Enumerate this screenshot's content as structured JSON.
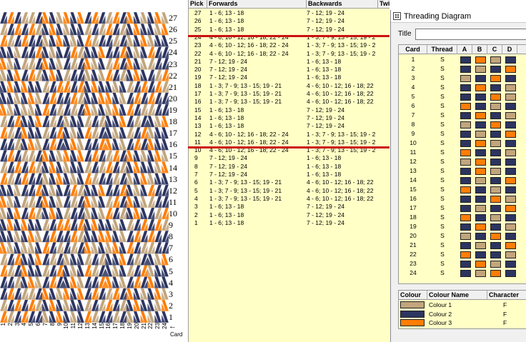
{
  "colors": {
    "colour1": "#c2a57c",
    "colour2": "#2c3460",
    "colour3": "#ff7d05",
    "red_line": "#cc1111",
    "table_bg": "#ffffc6"
  },
  "row_labels": [
    "27",
    "26",
    "25",
    "24",
    "23",
    "22",
    "21",
    "20",
    "19",
    "18",
    "17",
    "16",
    "15",
    "14",
    "13",
    "12",
    "11",
    "10",
    "9",
    "8",
    "7",
    "6",
    "5",
    "4",
    "3",
    "2",
    "1"
  ],
  "card_numbers": [
    "1",
    "2",
    "3",
    "4",
    "5",
    "6",
    "7",
    "8",
    "9",
    "10",
    "11",
    "12",
    "13",
    "14",
    "15",
    "16",
    "17",
    "18",
    "19",
    "20",
    "21",
    "22",
    "23",
    "24"
  ],
  "card_axis": {
    "label": "Card",
    "arrow": "←"
  },
  "pick_table": {
    "headers": {
      "pick": "Pick",
      "forwards": "Forwards",
      "backwards": "Backwards",
      "twist": "Twist"
    },
    "rows": [
      {
        "pick": "27",
        "forwards": "1 - 6; 13 - 18",
        "backwards": "7 - 12; 19 - 24"
      },
      {
        "pick": "26",
        "forwards": "1 - 6; 13 - 18",
        "backwards": "7 - 12; 19 - 24"
      },
      {
        "pick": "25",
        "forwards": "1 - 6; 13 - 18",
        "backwards": "7 - 12; 19 - 24"
      },
      {
        "pick": "24",
        "forwards": "4 - 6; 10 - 12; 16 - 18; 22 - 24",
        "backwards": "1 - 3; 7 - 9; 13 - 15; 19 - 2"
      },
      {
        "pick": "23",
        "forwards": "4 - 6; 10 - 12; 16 - 18; 22 - 24",
        "backwards": "1 - 3; 7 - 9; 13 - 15; 19 - 2"
      },
      {
        "pick": "22",
        "forwards": "4 - 6; 10 - 12; 16 - 18; 22 - 24",
        "backwards": "1 - 3; 7 - 9; 13 - 15; 19 - 2"
      },
      {
        "pick": "21",
        "forwards": "7 - 12; 19 - 24",
        "backwards": "1 - 6; 13 - 18"
      },
      {
        "pick": "20",
        "forwards": "7 - 12; 19 - 24",
        "backwards": "1 - 6; 13 - 18"
      },
      {
        "pick": "19",
        "forwards": "7 - 12; 19 - 24",
        "backwards": "1 - 6; 13 - 18"
      },
      {
        "pick": "18",
        "forwards": "1 - 3; 7 - 9; 13 - 15; 19 - 21",
        "backwards": "4 - 6; 10 - 12; 16 - 18; 22"
      },
      {
        "pick": "17",
        "forwards": "1 - 3; 7 - 9; 13 - 15; 19 - 21",
        "backwards": "4 - 6; 10 - 12; 16 - 18; 22"
      },
      {
        "pick": "16",
        "forwards": "1 - 3; 7 - 9; 13 - 15; 19 - 21",
        "backwards": "4 - 6; 10 - 12; 16 - 18; 22"
      },
      {
        "pick": "15",
        "forwards": "1 - 6; 13 - 18",
        "backwards": "7 - 12; 19 - 24"
      },
      {
        "pick": "14",
        "forwards": "1 - 6; 13 - 18",
        "backwards": "7 - 12; 19 - 24"
      },
      {
        "pick": "13",
        "forwards": "1 - 6; 13 - 18",
        "backwards": "7 - 12; 19 - 24"
      },
      {
        "pick": "12",
        "forwards": "4 - 6; 10 - 12; 16 - 18; 22 - 24",
        "backwards": "1 - 3; 7 - 9; 13 - 15; 19 - 2"
      },
      {
        "pick": "11",
        "forwards": "4 - 6; 10 - 12; 16 - 18; 22 - 24",
        "backwards": "1 - 3; 7 - 9; 13 - 15; 19 - 2"
      },
      {
        "pick": "10",
        "forwards": "4 - 6; 10 - 12; 16 - 18; 22 - 24",
        "backwards": "1 - 3; 7 - 9; 13 - 15; 19 - 2"
      },
      {
        "pick": "9",
        "forwards": "7 - 12; 19 - 24",
        "backwards": "1 - 6; 13 - 18"
      },
      {
        "pick": "8",
        "forwards": "7 - 12; 19 - 24",
        "backwards": "1 - 6; 13 - 18"
      },
      {
        "pick": "7",
        "forwards": "7 - 12; 19 - 24",
        "backwards": "1 - 6; 13 - 18"
      },
      {
        "pick": "6",
        "forwards": "1 - 3; 7 - 9; 13 - 15; 19 - 21",
        "backwards": "4 - 6; 10 - 12; 16 - 18; 22"
      },
      {
        "pick": "5",
        "forwards": "1 - 3; 7 - 9; 13 - 15; 19 - 21",
        "backwards": "4 - 6; 10 - 12; 16 - 18; 22"
      },
      {
        "pick": "4",
        "forwards": "1 - 3; 7 - 9; 13 - 15; 19 - 21",
        "backwards": "4 - 6; 10 - 12; 16 - 18; 22"
      },
      {
        "pick": "3",
        "forwards": "1 - 6; 13 - 18",
        "backwards": "7 - 12; 19 - 24"
      },
      {
        "pick": "2",
        "forwards": "1 - 6; 13 - 18",
        "backwards": "7 - 12; 19 - 24"
      },
      {
        "pick": "1",
        "forwards": "1 - 6; 13 - 18",
        "backwards": "7 - 12; 19 - 24"
      }
    ]
  },
  "threading_window": {
    "title": "Threading Diagram",
    "title_label": "Title",
    "title_value": "",
    "headers": {
      "card": "Card",
      "thread": "Thread",
      "a": "A",
      "b": "B",
      "c": "C",
      "d": "D"
    },
    "cards": [
      {
        "card": "1",
        "thread": "S",
        "holes": [
          2,
          3,
          1,
          2
        ]
      },
      {
        "card": "2",
        "thread": "S",
        "holes": [
          2,
          1,
          2,
          3
        ]
      },
      {
        "card": "3",
        "thread": "S",
        "holes": [
          1,
          2,
          3,
          2
        ]
      },
      {
        "card": "4",
        "thread": "S",
        "holes": [
          2,
          3,
          2,
          1
        ]
      },
      {
        "card": "5",
        "thread": "S",
        "holes": [
          2,
          2,
          3,
          1
        ]
      },
      {
        "card": "6",
        "thread": "S",
        "holes": [
          3,
          2,
          1,
          2
        ]
      },
      {
        "card": "7",
        "thread": "S",
        "holes": [
          2,
          3,
          2,
          1
        ]
      },
      {
        "card": "8",
        "thread": "S",
        "holes": [
          1,
          2,
          3,
          2
        ]
      },
      {
        "card": "9",
        "thread": "S",
        "holes": [
          2,
          1,
          2,
          3
        ]
      },
      {
        "card": "10",
        "thread": "S",
        "holes": [
          2,
          3,
          1,
          2
        ]
      },
      {
        "card": "11",
        "thread": "S",
        "holes": [
          3,
          2,
          2,
          1
        ]
      },
      {
        "card": "12",
        "thread": "S",
        "holes": [
          1,
          3,
          2,
          2
        ]
      },
      {
        "card": "13",
        "thread": "S",
        "holes": [
          2,
          3,
          1,
          2
        ]
      },
      {
        "card": "14",
        "thread": "S",
        "holes": [
          2,
          1,
          2,
          3
        ]
      },
      {
        "card": "15",
        "thread": "S",
        "holes": [
          3,
          2,
          1,
          2
        ]
      },
      {
        "card": "16",
        "thread": "S",
        "holes": [
          2,
          2,
          3,
          1
        ]
      },
      {
        "card": "17",
        "thread": "S",
        "holes": [
          2,
          1,
          2,
          3
        ]
      },
      {
        "card": "18",
        "thread": "S",
        "holes": [
          3,
          2,
          1,
          2
        ]
      },
      {
        "card": "19",
        "thread": "S",
        "holes": [
          2,
          3,
          2,
          1
        ]
      },
      {
        "card": "20",
        "thread": "S",
        "holes": [
          1,
          2,
          3,
          2
        ]
      },
      {
        "card": "21",
        "thread": "S",
        "holes": [
          2,
          1,
          2,
          3
        ]
      },
      {
        "card": "22",
        "thread": "S",
        "holes": [
          3,
          2,
          2,
          1
        ]
      },
      {
        "card": "23",
        "thread": "S",
        "holes": [
          2,
          3,
          1,
          2
        ]
      },
      {
        "card": "24",
        "thread": "S",
        "holes": [
          2,
          1,
          3,
          2
        ]
      }
    ],
    "colour_list": {
      "headers": {
        "colour": "Colour",
        "name": "Colour Name",
        "character": "Character"
      },
      "rows": [
        {
          "swatch": "colour1",
          "name": "Colour 1",
          "character": "F"
        },
        {
          "swatch": "colour2",
          "name": "Colour 2",
          "character": "F"
        },
        {
          "swatch": "colour3",
          "name": "Colour 3",
          "character": "F"
        }
      ]
    }
  }
}
